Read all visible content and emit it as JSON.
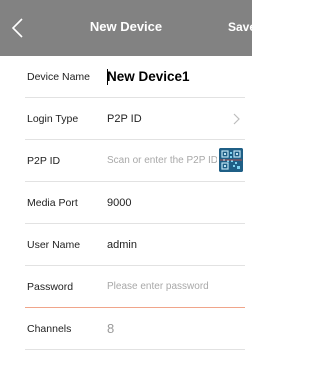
{
  "header": {
    "title": "New Device",
    "save_label": "Save",
    "back_icon": "chevron-left-icon"
  },
  "form": {
    "device_name": {
      "label": "Device Name",
      "value": "New Device1"
    },
    "login_type": {
      "label": "Login Type",
      "value": "P2P ID",
      "icon": "chevron-right-icon"
    },
    "p2p_id": {
      "label": "P2P ID",
      "placeholder": "Scan or enter the P2P ID",
      "icon": "qr-scan-icon"
    },
    "media_port": {
      "label": "Media Port",
      "value": "9000"
    },
    "user_name": {
      "label": "User Name",
      "value": "admin"
    },
    "password": {
      "label": "Password",
      "placeholder": "Please enter password"
    },
    "channels": {
      "label": "Channels",
      "value": "8"
    }
  },
  "colors": {
    "header_bg": "#828282",
    "divider": "#e2e2e2",
    "active_underline": "#f0a58a",
    "qr_bg": "#1f5f86"
  }
}
